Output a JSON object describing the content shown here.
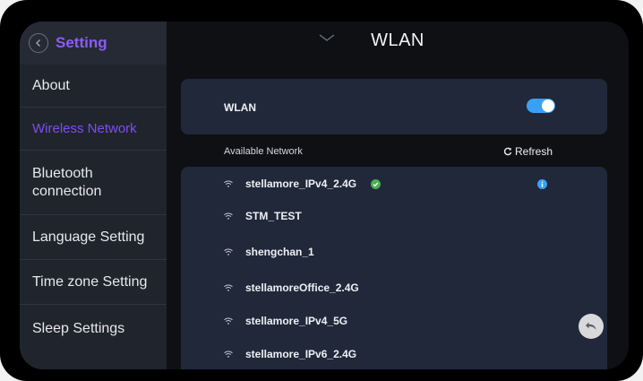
{
  "sidebar": {
    "title": "Setting",
    "items": [
      {
        "label": "About"
      },
      {
        "label": "Wireless Network"
      },
      {
        "label": "Bluetooth connection"
      },
      {
        "label": "Language Setting"
      },
      {
        "label": "Time zone Setting"
      },
      {
        "label": "Sleep Settings"
      }
    ]
  },
  "header": {
    "title": "WLAN"
  },
  "wlan": {
    "label": "WLAN",
    "enabled": true
  },
  "available": {
    "label": "Available Network",
    "refresh_label": "Refresh"
  },
  "networks": [
    {
      "name": "stellamore_IPv4_2.4G",
      "connected": true
    },
    {
      "name": "STM_TEST"
    },
    {
      "name": "shengchan_1"
    },
    {
      "name": "stellamoreOffice_2.4G"
    },
    {
      "name": "stellamore_IPv4_5G"
    },
    {
      "name": "stellamore_IPv6_2.4G"
    }
  ],
  "colors": {
    "accent": "#8b5cf6",
    "toggle_on": "#3aa0f5",
    "connected_check": "#4caf50",
    "info": "#3aa0f5"
  },
  "icons": [
    "back-arrow-icon",
    "chevron-down-icon",
    "wifi-icon",
    "check-circle-icon",
    "info-icon",
    "refresh-icon",
    "return-icon"
  ]
}
